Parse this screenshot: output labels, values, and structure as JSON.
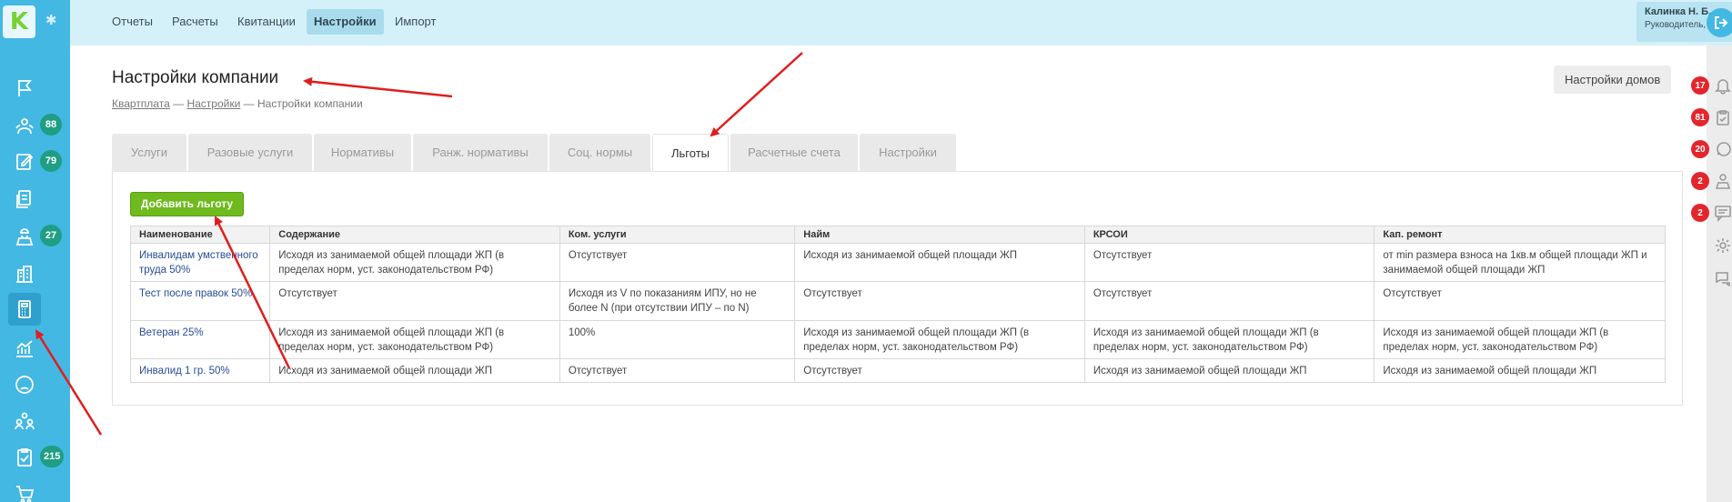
{
  "topbar": {
    "nav": [
      {
        "label": "Отчеты"
      },
      {
        "label": "Расчеты"
      },
      {
        "label": "Квитанции"
      },
      {
        "label": "Настройки"
      },
      {
        "label": "Импорт"
      }
    ],
    "user": {
      "name": "Калинка Н. Б.",
      "role": "Руководитель, Клюковка"
    }
  },
  "sidebar": {
    "logo": "K",
    "badges": [
      "88",
      "79",
      "27",
      "215"
    ]
  },
  "rightbar": {
    "badges": [
      "17",
      "81",
      "20",
      "2",
      "2"
    ]
  },
  "page": {
    "title": "Настройки компании",
    "breadcrumb": [
      "Квартплата",
      "Настройки",
      "Настройки компании"
    ],
    "breadcrumb_sep": "—",
    "houses_button": "Настройки домов"
  },
  "tabs": [
    {
      "label": "Услуги"
    },
    {
      "label": "Разовые услуги"
    },
    {
      "label": "Нормативы"
    },
    {
      "label": "Ранж. нормативы"
    },
    {
      "label": "Соц. нормы"
    },
    {
      "label": "Льготы"
    },
    {
      "label": "Расчетные счета"
    },
    {
      "label": "Настройки"
    }
  ],
  "add_button": "Добавить льготу",
  "table": {
    "headers": [
      "Наименование",
      "Содержание",
      "Ком. услуги",
      "Найм",
      "КРСОИ",
      "Кап. ремонт"
    ],
    "rows": [
      [
        "Инвалидам умственного труда 50%",
        "Исходя из занимаемой общей площади ЖП (в пределах норм, уст. законодательством РФ)",
        "Отсутствует",
        "Исходя из занимаемой общей площади ЖП",
        "Отсутствует",
        "от min размера взноса на 1кв.м общей площади ЖП и занимаемой общей площади ЖП"
      ],
      [
        "Тест после правок 50%",
        "Отсутствует",
        "Исходя из V по показаниям ИПУ, но не более N (при отсутствии ИПУ – по N)",
        "Отсутствует",
        "Отсутствует",
        "Отсутствует"
      ],
      [
        "Ветеран 25%",
        "Исходя из занимаемой общей площади ЖП (в пределах норм, уст. законодательством РФ)",
        "100%",
        "Исходя из занимаемой общей площади ЖП (в пределах норм, уст. законодательством РФ)",
        "Исходя из занимаемой общей площади ЖП (в пределах норм, уст. законодательством РФ)",
        "Исходя из занимаемой общей площади ЖП (в пределах норм, уст. законодательством РФ)"
      ],
      [
        "Инвалид 1 гр. 50%",
        "Исходя из занимаемой общей площади ЖП",
        "Отсутствует",
        "Отсутствует",
        "Исходя из занимаемой общей площади ЖП",
        "Исходя из занимаемой общей площади ЖП"
      ]
    ]
  },
  "colors": {
    "accent": "#43b8e3",
    "add_button": "#6fba1e",
    "badge_green": "#1f9e84",
    "badge_red": "#e3262d",
    "arrow": "#e11d1d"
  }
}
